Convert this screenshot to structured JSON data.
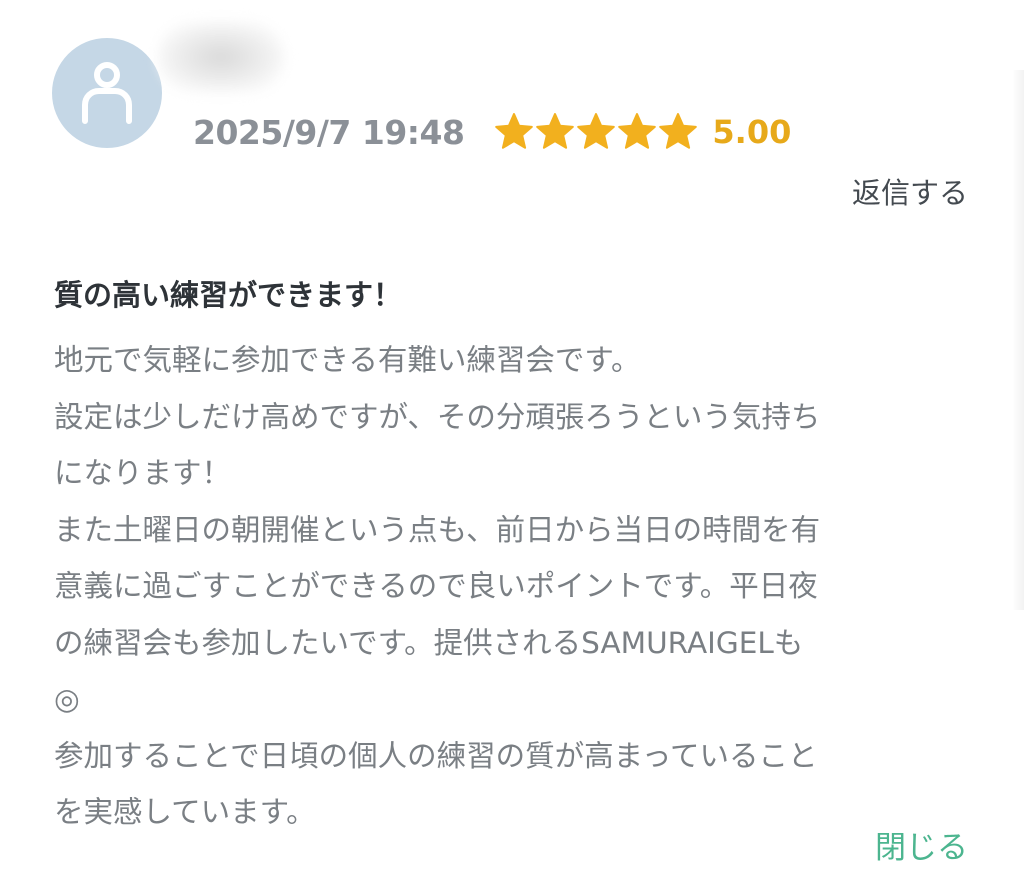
{
  "review": {
    "date": "2025/9/7 19:48",
    "rating": 5,
    "rating_max": 5,
    "rating_text": "5.00",
    "reply_label": "返信する",
    "title": "質の高い練習ができます！",
    "body_lines": [
      "地元で気軽に参加できる有難い練習会です。",
      "設定は少しだけ高めですが、その分頑張ろうという気持ち",
      "になります！",
      "また土曜日の朝開催という点も、前日から当日の時間を有",
      "意義に過ごすことができるので良いポイントです。平日夜",
      "の練習会も参加したいです。提供されるSAMURAIGELも",
      "◎",
      "参加することで日頃の個人の練習の質が高まっていること",
      "を実感しています。"
    ],
    "close_label": "閉じる"
  },
  "icons": {
    "avatar": "user-icon",
    "star": "star-icon"
  },
  "colors": {
    "avatar_bg": "#c5d7e6",
    "star": "#f2b01e",
    "rating_text": "#e7a91a",
    "date_text": "#8b9097",
    "body_text": "#7a7f84",
    "close_link": "#4cb58f"
  }
}
